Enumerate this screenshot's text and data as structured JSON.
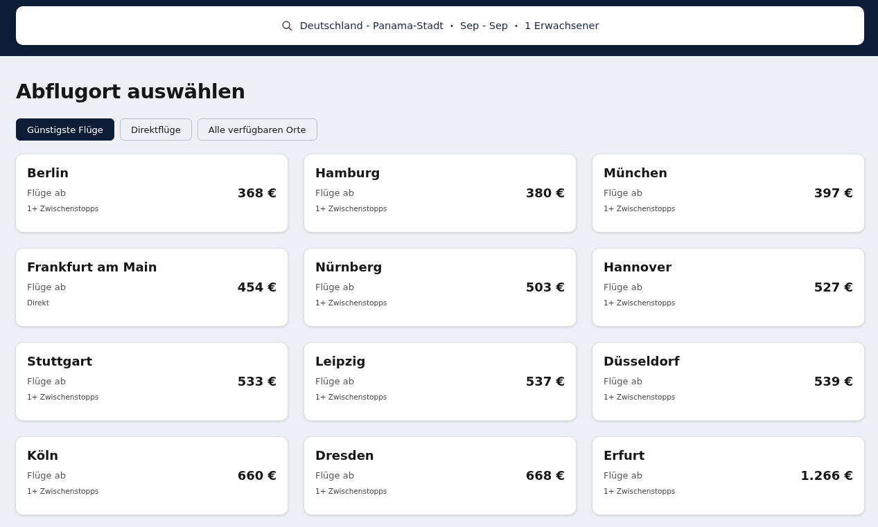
{
  "search_summary": {
    "parts": [
      "Deutschland - Panama-Stadt",
      "Sep - Sep",
      "1 Erwachsener"
    ],
    "separator": "•"
  },
  "title": "Abflugort auswählen",
  "filters": [
    {
      "label": "Günstigste Flüge",
      "selected": true
    },
    {
      "label": "Direktflüge",
      "selected": false
    },
    {
      "label": "Alle verfügbaren Orte",
      "selected": false
    }
  ],
  "destinations": [
    {
      "city": "Berlin",
      "label": "Flüge ab",
      "price": "368 €",
      "stops": "1+ Zwischenstopps"
    },
    {
      "city": "Hamburg",
      "label": "Flüge ab",
      "price": "380 €",
      "stops": "1+ Zwischenstopps"
    },
    {
      "city": "München",
      "label": "Flüge ab",
      "price": "397 €",
      "stops": "1+ Zwischenstopps"
    },
    {
      "city": "Frankfurt am Main",
      "label": "Flüge ab",
      "price": "454 €",
      "stops": "Direkt"
    },
    {
      "city": "Nürnberg",
      "label": "Flüge ab",
      "price": "503 €",
      "stops": "1+ Zwischenstopps"
    },
    {
      "city": "Hannover",
      "label": "Flüge ab",
      "price": "527 €",
      "stops": "1+ Zwischenstopps"
    },
    {
      "city": "Stuttgart",
      "label": "Flüge ab",
      "price": "533 €",
      "stops": "1+ Zwischenstopps"
    },
    {
      "city": "Leipzig",
      "label": "Flüge ab",
      "price": "537 €",
      "stops": "1+ Zwischenstopps"
    },
    {
      "city": "Düsseldorf",
      "label": "Flüge ab",
      "price": "539 €",
      "stops": "1+ Zwischenstopps"
    },
    {
      "city": "Köln",
      "label": "Flüge ab",
      "price": "660 €",
      "stops": "1+ Zwischenstopps"
    },
    {
      "city": "Dresden",
      "label": "Flüge ab",
      "price": "668 €",
      "stops": "1+ Zwischenstopps"
    },
    {
      "city": "Erfurt",
      "label": "Flüge ab",
      "price": "1.266 €",
      "stops": "1+ Zwischenstopps"
    }
  ]
}
